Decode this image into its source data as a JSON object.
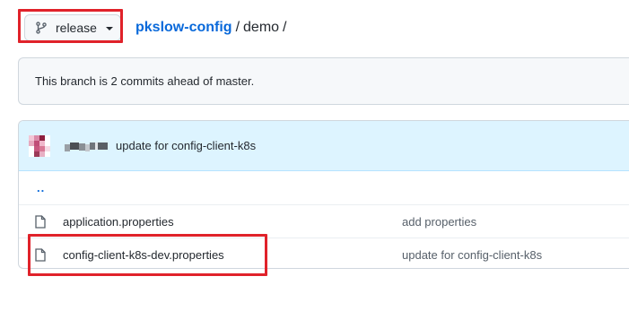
{
  "branch": {
    "name": "release",
    "icon": "git-branch-icon"
  },
  "breadcrumb": {
    "repo": "pkslow-config",
    "separator": "/",
    "dir": "demo",
    "trailing": "/"
  },
  "ahead_notice": "This branch is 2 commits ahead of master.",
  "latest_commit": {
    "message": "update for config-client-k8s"
  },
  "files": {
    "parent": "..",
    "rows": [
      {
        "name": "application.properties",
        "commit": "add properties",
        "icon": "file-icon"
      },
      {
        "name": "config-client-k8s-dev.properties",
        "commit": "update for config-client-k8s",
        "icon": "file-icon"
      }
    ]
  },
  "colors": {
    "accent": "#0969da",
    "highlight": "#e0222a",
    "header_bg": "#ddf4ff"
  }
}
